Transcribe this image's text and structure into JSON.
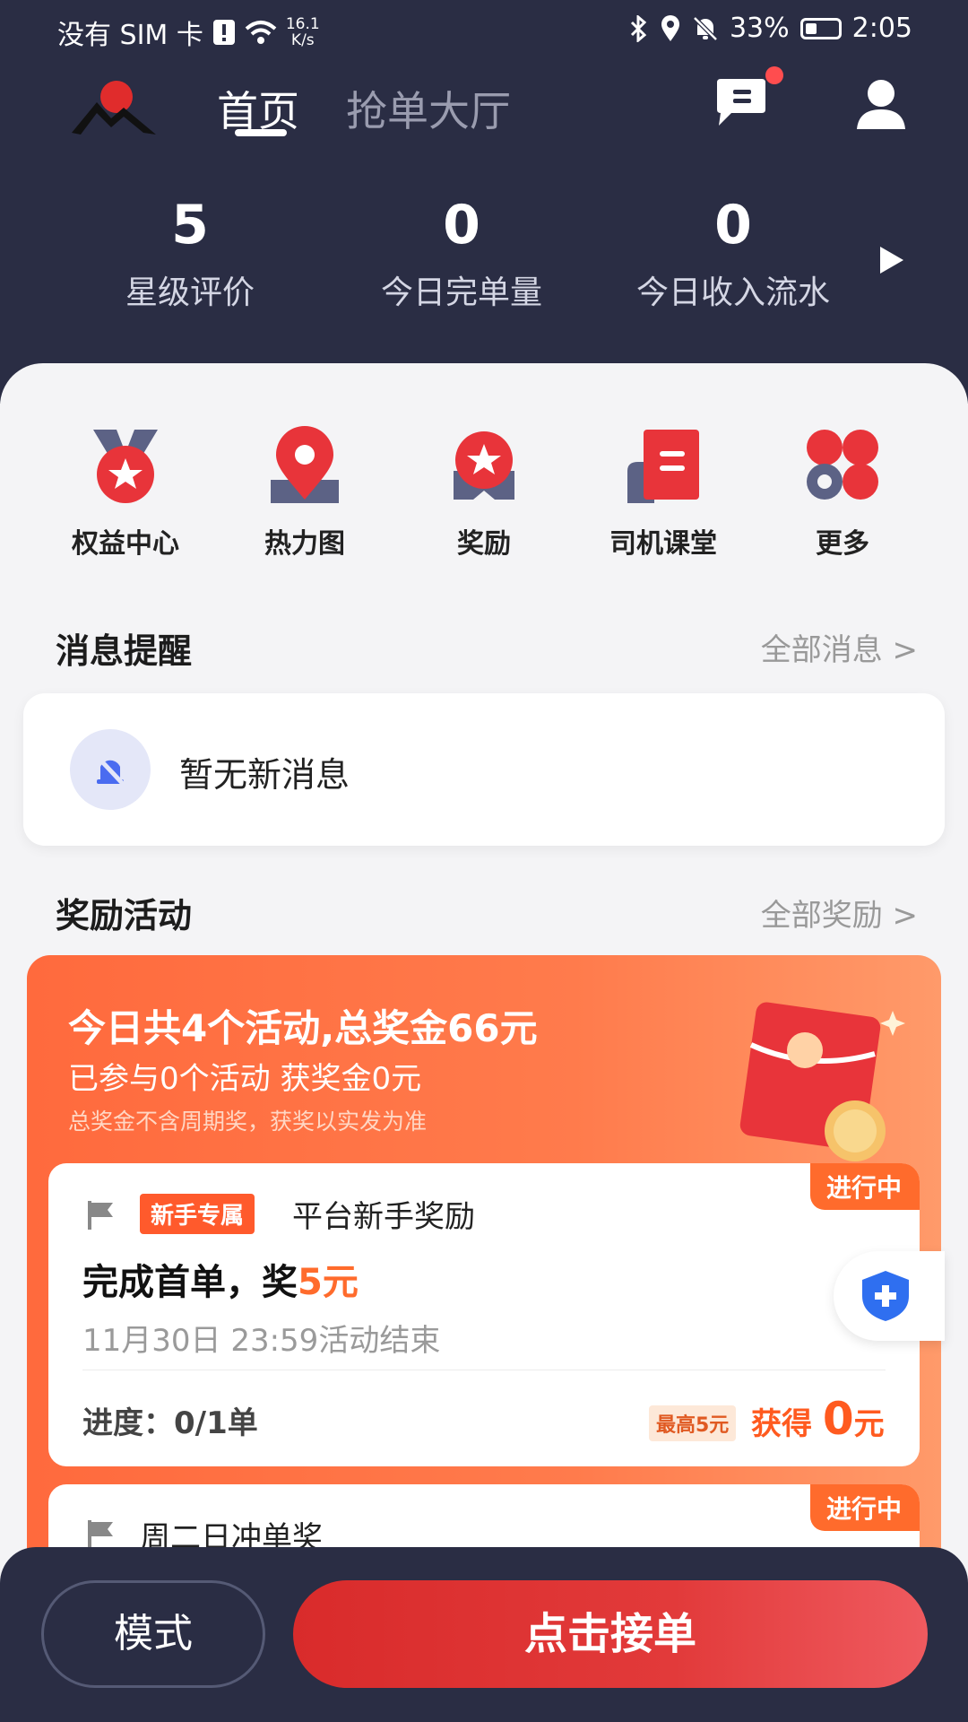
{
  "status_bar": {
    "carrier": "没有 SIM 卡",
    "net_speed_value": "16.1",
    "net_speed_unit": "K/s",
    "battery": "33%",
    "time": "2:05"
  },
  "nav": {
    "tabs": [
      {
        "label": "首页",
        "active": true
      },
      {
        "label": "抢单大厅",
        "active": false
      }
    ],
    "message_icon": "chat-icon",
    "profile_icon": "user-icon"
  },
  "stats": [
    {
      "value": "5",
      "label": "星级评价"
    },
    {
      "value": "0",
      "label": "今日完单量"
    },
    {
      "value": "0",
      "label": "今日收入流水"
    }
  ],
  "quick_menu": [
    {
      "label": "权益中心",
      "icon": "medal-icon"
    },
    {
      "label": "热力图",
      "icon": "location-pin-icon"
    },
    {
      "label": "奖励",
      "icon": "award-icon"
    },
    {
      "label": "司机课堂",
      "icon": "book-icon"
    },
    {
      "label": "更多",
      "icon": "grid-icon"
    }
  ],
  "messages": {
    "title": "消息提醒",
    "link": "全部消息 >",
    "empty_text": "暂无新消息"
  },
  "rewards": {
    "title": "奖励活动",
    "link": "全部奖励 >",
    "summary": "今日共4个活动,总奖金66元",
    "participation": "已参与0个活动 获奖金0元",
    "note": "总奖金不含周期奖，获奖以实发为准",
    "cards": [
      {
        "status": "进行中",
        "tag": "新手专属",
        "name": "平台新手奖励",
        "main_prefix": "完成首单，奖",
        "main_highlight": "5元",
        "end_time": "11月30日 23:59活动结束",
        "progress": "进度：0/1单",
        "max_badge": "最高5元",
        "earned_prefix": "获得",
        "earned_value": "0",
        "earned_unit": "元"
      },
      {
        "status": "进行中",
        "name": "周二日冲单奖"
      }
    ]
  },
  "bottom": {
    "mode_label": "模式",
    "accept_label": "点击接单"
  },
  "colors": {
    "header_bg": "#2a2d44",
    "accent_orange": "#ff6b2c",
    "accent_red": "#e23a3a"
  }
}
